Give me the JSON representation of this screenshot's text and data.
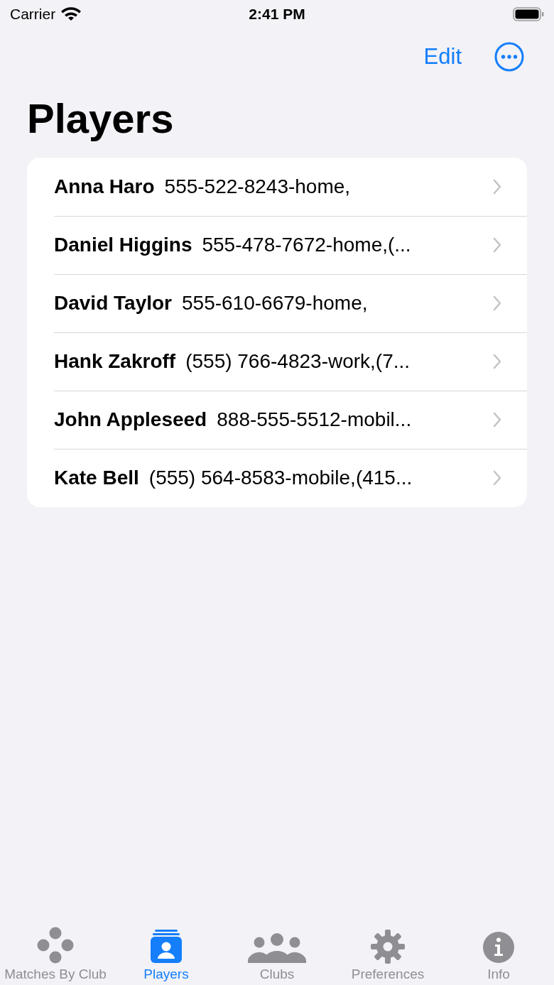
{
  "status_bar": {
    "carrier": "Carrier",
    "time": "2:41 PM"
  },
  "nav_bar": {
    "edit": "Edit",
    "title": "Players"
  },
  "players": [
    {
      "name": "Anna Haro",
      "detail": "555-522-8243-home,"
    },
    {
      "name": "Daniel Higgins",
      "detail": "555-478-7672-home,(..."
    },
    {
      "name": "David Taylor",
      "detail": "555-610-6679-home,"
    },
    {
      "name": "Hank Zakroff",
      "detail": "(555) 766-4823-work,(7..."
    },
    {
      "name": "John Appleseed",
      "detail": "888-555-5512-mobil..."
    },
    {
      "name": "Kate Bell",
      "detail": "(555) 564-8583-mobile,(415..."
    }
  ],
  "tab_bar": [
    {
      "kind": "dots",
      "label": "Matches By Club",
      "selected": false
    },
    {
      "kind": "person",
      "label": "Players",
      "selected": true
    },
    {
      "kind": "group",
      "label": "Clubs",
      "selected": false
    },
    {
      "kind": "gear",
      "label": "Preferences",
      "selected": false
    },
    {
      "kind": "info",
      "label": "Info",
      "selected": false
    }
  ]
}
